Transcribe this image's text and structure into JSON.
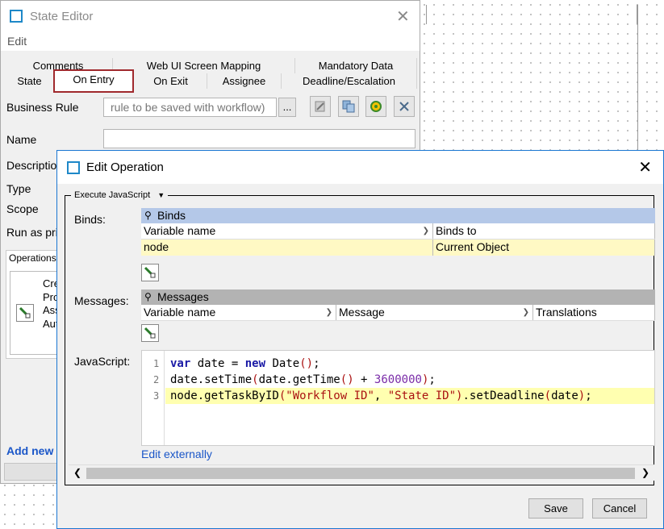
{
  "state_editor": {
    "title": "State Editor",
    "menu_edit": "Edit",
    "tabs_top": [
      "Comments",
      "Web UI Screen Mapping",
      "Mandatory Data"
    ],
    "tabs_bottom": [
      "State",
      "On Entry",
      "On Exit",
      "Assignee",
      "Deadline/Escalation"
    ],
    "labels": {
      "business_rule": "Business Rule",
      "name": "Name",
      "description": "Description",
      "type": "Type",
      "scope": "Scope",
      "run_as": "Run as pri",
      "operations": "Operations"
    },
    "business_rule_value": "rule to be saved with workflow)",
    "ellipsis": "...",
    "ops_lines": [
      "Cre",
      "Pro",
      "Ass",
      "Aut"
    ],
    "add_new": "Add new"
  },
  "edit_operation": {
    "title": "Edit Operation",
    "panel_legend": "Execute JavaScript",
    "binds": {
      "label": "Binds:",
      "title": "Binds",
      "columns": [
        "Variable name",
        "Binds to"
      ],
      "rows": [
        [
          "node",
          "Current Object"
        ]
      ]
    },
    "messages": {
      "label": "Messages:",
      "title": "Messages",
      "columns": [
        "Variable name",
        "Message",
        "Translations"
      ]
    },
    "javascript": {
      "label": "JavaScript:",
      "line_numbers": [
        "1",
        "2",
        "3"
      ],
      "lines": [
        "var date = new Date();",
        "date.setTime(date.getTime() + 3600000);",
        "node.getTaskByID(\"Workflow ID\", \"State ID\").setDeadline(date);"
      ]
    },
    "edit_externally": "Edit externally",
    "save": "Save",
    "cancel": "Cancel"
  },
  "icons": [
    "window-icon",
    "close-icon",
    "pin-icon",
    "add-row-icon",
    "dropdown-caret-icon"
  ]
}
